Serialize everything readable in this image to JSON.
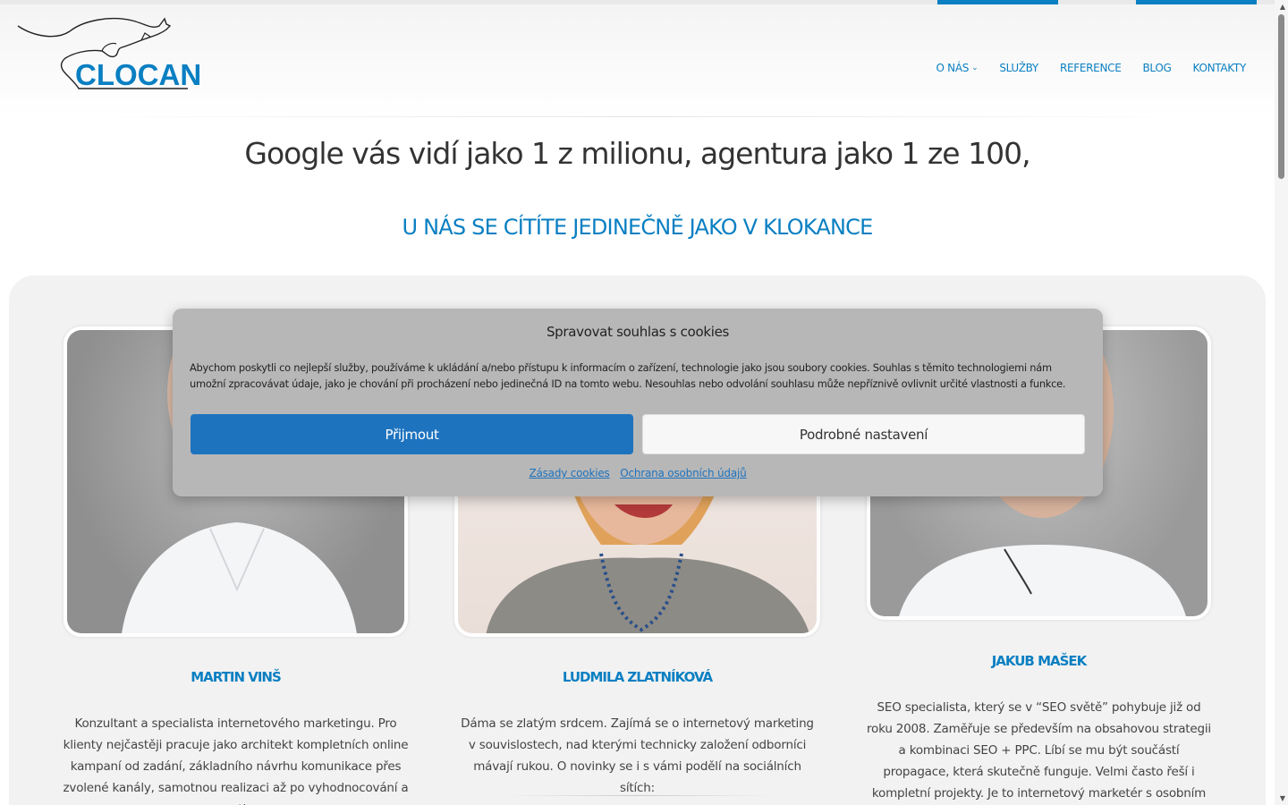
{
  "logo": {
    "text": "CLOCAN"
  },
  "nav": {
    "items": [
      {
        "label": "O NÁS"
      },
      {
        "label": "SLUŽBY"
      },
      {
        "label": "REFERENCE"
      },
      {
        "label": "BLOG"
      },
      {
        "label": "KONTAKTY"
      }
    ],
    "dropdown_icon": "chevron-down-icon"
  },
  "hero": {
    "title": "Google vás vidí jako 1 z milionu, agentura jako 1 ze 100,",
    "subtitle": "U NÁS SE CÍTÍTE JEDINEČNĚ JAKO V KLOKANCE"
  },
  "team": [
    {
      "name": "MARTIN VINŠ",
      "description": "Konzultant a specialista internetového marketingu. Pro klienty nejčastěji pracuje jako architekt kompletních online kampaní od zadání, základního návrhu komunikace přes zvolené kanály, samotnou realizaci až po vyhodnocování a reporting."
    },
    {
      "name": "LUDMILA ZLATNÍKOVÁ",
      "description": "Dáma se zlatým srdcem. Zajímá se o internetový marketing v souvislostech, nad kterými technicky založení odborníci mávají rukou. O novinky se i s vámi podělí na sociálních sítích:"
    },
    {
      "name": "JAKUB MAŠEK",
      "description": "SEO specialista, který se v “SEO světě” pohybuje již od roku 2008. Zaměřuje se především na obsahovou strategii a kombinaci SEO + PPC. Líbí se mu být součástí propagace, která skutečně funguje. Velmi často řeší i kompletní projekty. Je to internetový marketér s osobním přístupem."
    }
  ],
  "cookie_modal": {
    "title": "Spravovat souhlas s cookies",
    "text": "Abychom poskytli co nejlepší služby, používáme k ukládání a/nebo přístupu k informacím o zařízení, technologie jako jsou soubory cookies. Souhlas s těmito technologiemi nám umožní zpracovávat údaje, jako je chování při procházení nebo jedinečná ID na tomto webu. Nesouhlas nebo odvolání souhlasu může nepříznivě ovlivnit určité vlastnosti a funkce.",
    "accept_label": "Přijmout",
    "settings_label": "Podrobné nastavení",
    "link_cookies": "Zásady cookies",
    "link_privacy": "Ochrana osobních údajů"
  },
  "colors": {
    "brand": "#0a7fc2",
    "accept_button": "#1e73be",
    "modal_bg": "#b7b7b7",
    "section_bg": "#f2f2f2"
  }
}
